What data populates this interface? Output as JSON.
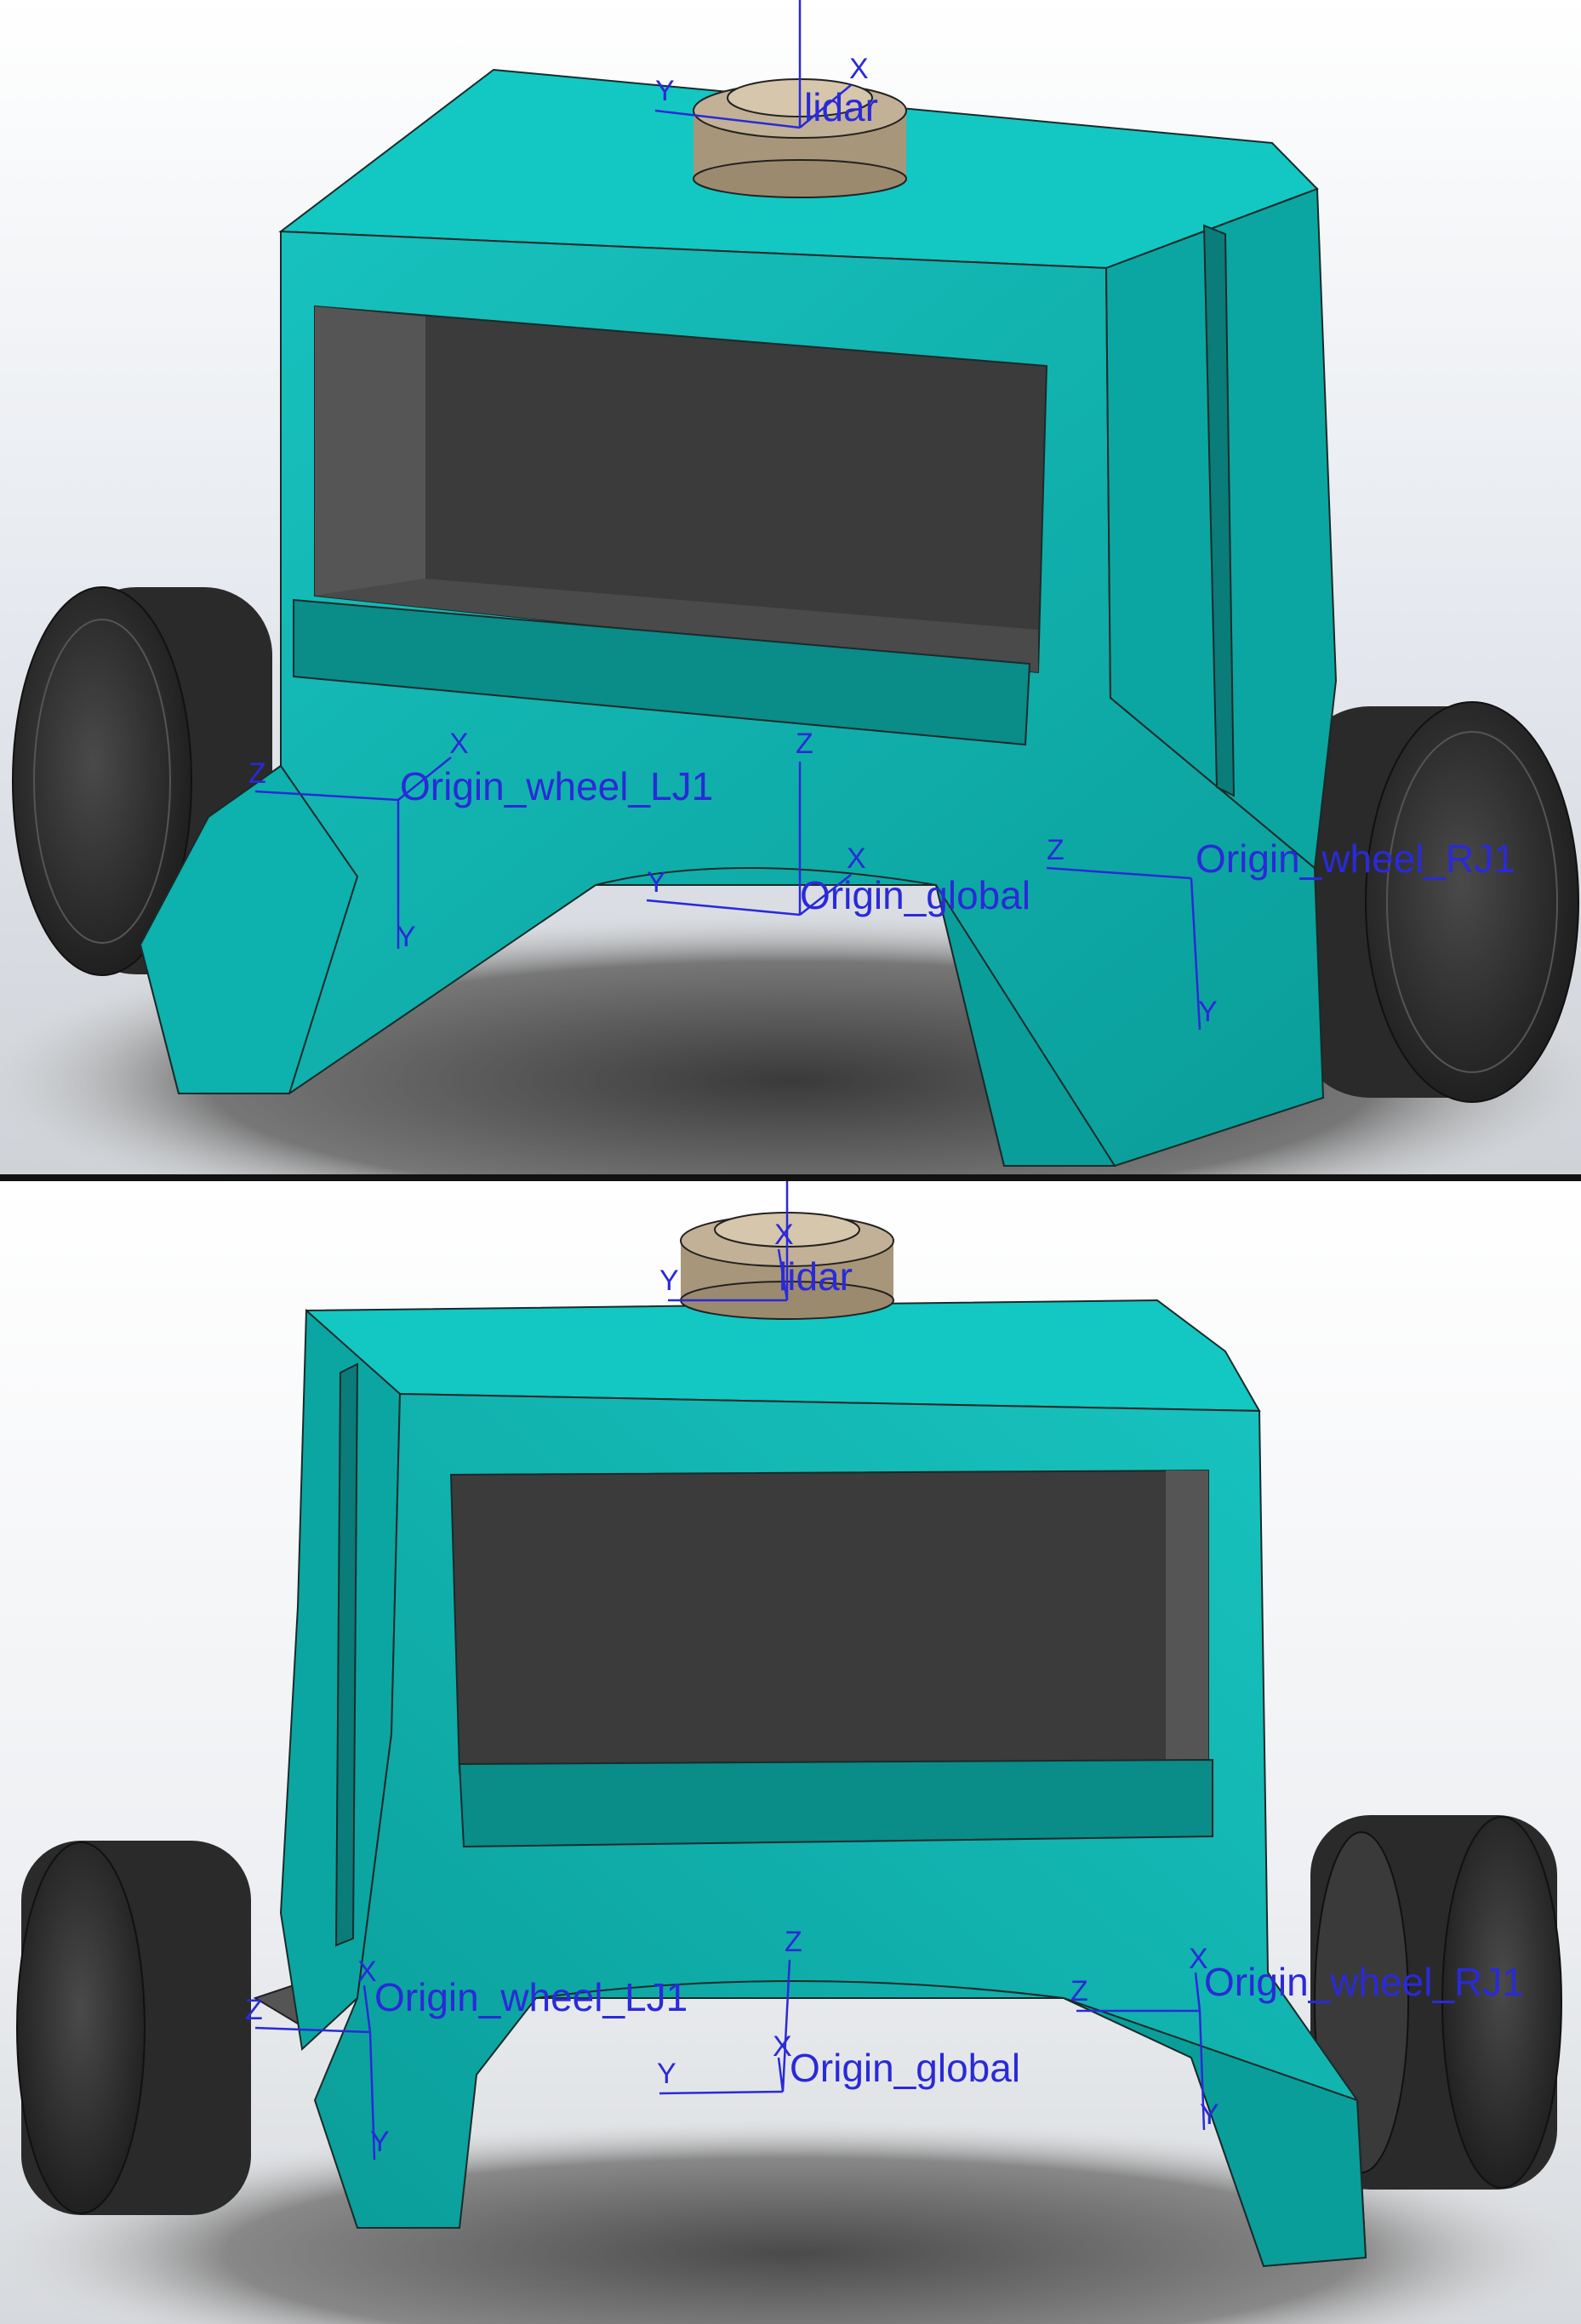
{
  "views": [
    {
      "name": "front-isometric",
      "frames": [
        {
          "label": "lidar",
          "axes": [
            "Y",
            "X"
          ]
        },
        {
          "label": "Origin_wheel_LJ1",
          "axes": [
            "X",
            "Z",
            "Y"
          ]
        },
        {
          "label": "Origin_global",
          "axes": [
            "Z",
            "Y",
            "X"
          ]
        },
        {
          "label": "Origin_wheel_RJ1",
          "axes": [
            "Z",
            "Y"
          ]
        }
      ]
    },
    {
      "name": "front-isometric-mirrored",
      "frames": [
        {
          "label": "lidar",
          "axes": [
            "Y",
            "X"
          ]
        },
        {
          "label": "Origin_wheel_LJ1",
          "axes": [
            "X",
            "Z",
            "Y"
          ]
        },
        {
          "label": "Origin_global",
          "axes": [
            "Z",
            "Y",
            "X"
          ]
        },
        {
          "label": "Origin_wheel_RJ1",
          "axes": [
            "X",
            "Z",
            "Y"
          ]
        }
      ]
    }
  ],
  "colors": {
    "body": "#0fb8b4",
    "body_dark": "#0a8c89",
    "cavity": "#3a3a3a",
    "wheel": "#333333",
    "lidar": "#b8a68a",
    "annotation": "#2a2ad8"
  }
}
